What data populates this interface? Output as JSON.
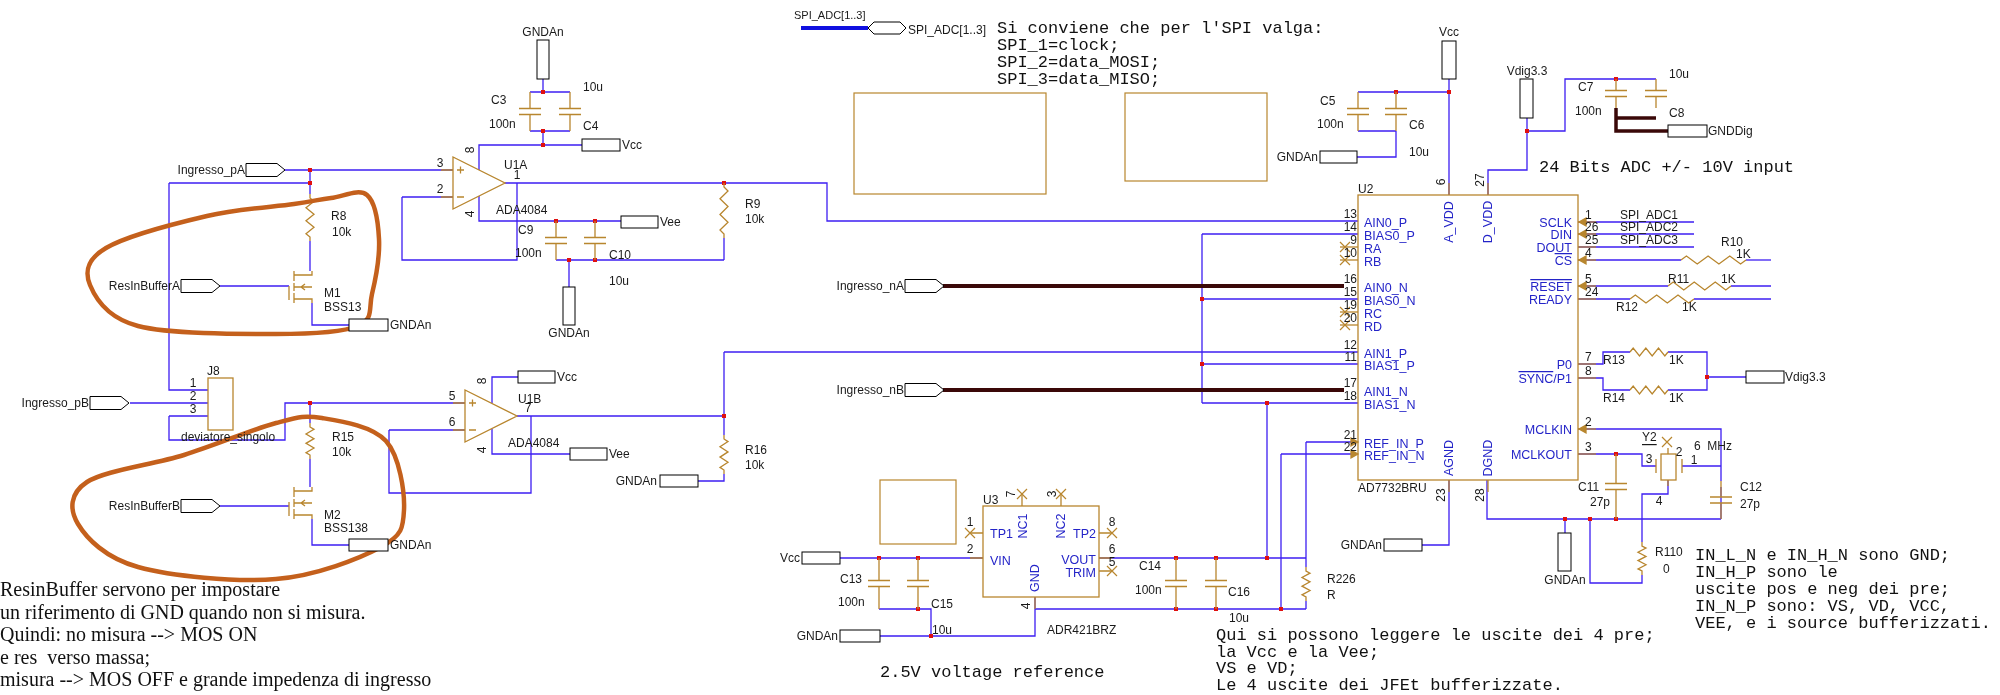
{
  "spi_bus": {
    "label": "SPI_ADC[1..3]",
    "port": "SPI_ADC[1..3]"
  },
  "notes": [
    {
      "kind": "mono",
      "lines": [
        "Si conviene che per l'SPI valga:",
        "SPI_1=clock;",
        "SPI_2=data_MOSI;",
        "SPI_3=data_MISO;"
      ]
    },
    {
      "kind": "mono",
      "lines": [
        "24 Bits ADC +/- 10V input"
      ]
    },
    {
      "kind": "mono",
      "lines": [
        "IN_L_N e IN_H_N sono GND;",
        "IN_H_P sono le",
        "uscite pos e neg dei pre;",
        "IN_N_P sono: VS, VD, VCC,",
        "VEE, e i source bufferizzati."
      ]
    },
    {
      "kind": "serif",
      "lines": [
        "ResinBuffer servono per impostare",
        "un riferimento di GND quando non si misura.",
        "Quindi: no misura --> MOS ON",
        "e res  verso massa;",
        "misura --> MOS OFF e grande impedenza di ingresso"
      ]
    },
    {
      "kind": "mono",
      "lines": [
        "2.5V voltage reference"
      ]
    },
    {
      "kind": "mono",
      "lines": [
        "Qui si possono leggere le uscite dei 4 pre;",
        "la Vcc e la Vee;",
        "VS e VD;",
        "Le 4 uscite dei JFEt bufferizzate."
      ]
    }
  ],
  "ports": [
    {
      "label": "Ingresso_pA"
    },
    {
      "label": "ResInBufferA"
    },
    {
      "label": "Ingresso_pB"
    },
    {
      "label": "ResInBufferB"
    },
    {
      "label": "Ingresso_nA"
    },
    {
      "label": "Ingresso_nB"
    }
  ],
  "power_flags": [
    {
      "label": "GNDAn"
    },
    {
      "label": "Vcc"
    },
    {
      "label": "GNDAn"
    },
    {
      "label": "Vee"
    },
    {
      "label": "GNDAn"
    },
    {
      "label": "Vcc"
    },
    {
      "label": "Vee"
    },
    {
      "label": "GNDAn"
    },
    {
      "label": "GNDAn"
    },
    {
      "label": "Vcc"
    },
    {
      "label": "GNDAn"
    },
    {
      "label": "Vcc"
    },
    {
      "label": "GNDAn"
    },
    {
      "label": "Vdig3.3"
    },
    {
      "label": "GNDDig"
    },
    {
      "label": "Vdig3.3"
    },
    {
      "label": "GNDAn"
    },
    {
      "label": "GNDAn"
    }
  ],
  "parts": [
    {
      "ref": "C3",
      "value": "100n"
    },
    {
      "ref": "C4",
      "value": "10u"
    },
    {
      "ref": "R8",
      "value": "10k"
    },
    {
      "ref": "M1",
      "value": "BSS13"
    },
    {
      "ref": "C9",
      "value": "100n"
    },
    {
      "ref": "C10",
      "value": "10u"
    },
    {
      "ref": "R9",
      "value": "10k"
    },
    {
      "ref": "R15",
      "value": "10k"
    },
    {
      "ref": "M2",
      "value": "BSS138"
    },
    {
      "ref": "R16",
      "value": "10k"
    },
    {
      "ref": "C5",
      "value": "100n"
    },
    {
      "ref": "C6",
      "value": "10u"
    },
    {
      "ref": "C7",
      "value": "100n"
    },
    {
      "ref": "C8",
      "value": "10u"
    },
    {
      "ref": "R10",
      "value": "1K"
    },
    {
      "ref": "R11",
      "value": "1K"
    },
    {
      "ref": "R12",
      "value": "1K"
    },
    {
      "ref": "R13",
      "value": "1K"
    },
    {
      "ref": "R14",
      "value": "1K"
    },
    {
      "ref": "C11",
      "value": "27p"
    },
    {
      "ref": "C12",
      "value": "27p"
    },
    {
      "ref": "Y2",
      "value": "6  MHz"
    },
    {
      "ref": "R110",
      "value": "0"
    },
    {
      "ref": "C13",
      "value": "100n"
    },
    {
      "ref": "C15",
      "value": "10u"
    },
    {
      "ref": "C14",
      "value": "100n"
    },
    {
      "ref": "C16",
      "value": "10u"
    },
    {
      "ref": "R226",
      "value": "R"
    }
  ],
  "opamps": [
    {
      "ref": "U1A",
      "part": "ADA4084",
      "pins": [
        "3",
        "2",
        "8",
        "4",
        "1"
      ]
    },
    {
      "ref": "U1B",
      "part": "ADA4084",
      "pins": [
        "5",
        "6",
        "8",
        "4",
        "7"
      ]
    }
  ],
  "switch": {
    "ref": "J8",
    "part": "deviatore_singolo",
    "pins": [
      "1",
      "2",
      "3"
    ]
  },
  "adc": {
    "ref": "U2",
    "part": "AD7732BRU",
    "left_pins": [
      {
        "num": "13",
        "name": "AIN0_P"
      },
      {
        "num": "14",
        "name": "BIAS0_P"
      },
      {
        "num": "9",
        "name": "RA"
      },
      {
        "num": "10",
        "name": "RB"
      },
      {
        "num": "16",
        "name": "AIN0_N"
      },
      {
        "num": "15",
        "name": "BIAS0_N"
      },
      {
        "num": "19",
        "name": "RC"
      },
      {
        "num": "20",
        "name": "RD"
      },
      {
        "num": "12",
        "name": "AIN1_P"
      },
      {
        "num": "11",
        "name": "BIAS1_P"
      },
      {
        "num": "17",
        "name": "AIN1_N"
      },
      {
        "num": "18",
        "name": "BIAS1_N"
      },
      {
        "num": "21",
        "name": "REF_IN_P"
      },
      {
        "num": "22",
        "name": "REF_IN_N"
      }
    ],
    "right_pins": [
      {
        "num": "1",
        "name": "SCLK"
      },
      {
        "num": "26",
        "name": "DIN"
      },
      {
        "num": "25",
        "name": "DOUT"
      },
      {
        "num": "4",
        "bar": "CS"
      },
      {
        "num": "5",
        "bar": "RESET"
      },
      {
        "num": "24",
        "name": "READY"
      },
      {
        "num": "7",
        "name": "P0"
      },
      {
        "num": "8",
        "bar": "SYNC",
        "name": "/P1"
      },
      {
        "num": "2",
        "name": "MCLKIN"
      },
      {
        "num": "3",
        "name": "MCLKOUT"
      }
    ],
    "power_pins": [
      {
        "num": "6",
        "name": "A_VDD"
      },
      {
        "num": "27",
        "name": "D_VDD"
      },
      {
        "num": "23",
        "name": "AGND"
      },
      {
        "num": "28",
        "name": "DGND"
      }
    ],
    "spi_nets": [
      "SPI_ADC1",
      "SPI_ADC2",
      "SPI_ADC3"
    ]
  },
  "reference": {
    "ref": "U3",
    "part": "ADR421BRZ",
    "pins": [
      {
        "num": "1",
        "name": "TP1"
      },
      {
        "num": "7",
        "name": "NC1"
      },
      {
        "num": "3",
        "name": "NC2"
      },
      {
        "num": "8",
        "name": "TP2"
      },
      {
        "num": "2",
        "name": "VIN"
      },
      {
        "num": "6",
        "name": "VOUT"
      },
      {
        "num": "5",
        "name": "TRIM"
      },
      {
        "num": "4",
        "name": "GND"
      }
    ]
  },
  "crystal_pins": [
    "3",
    "1",
    "2",
    "4"
  ]
}
